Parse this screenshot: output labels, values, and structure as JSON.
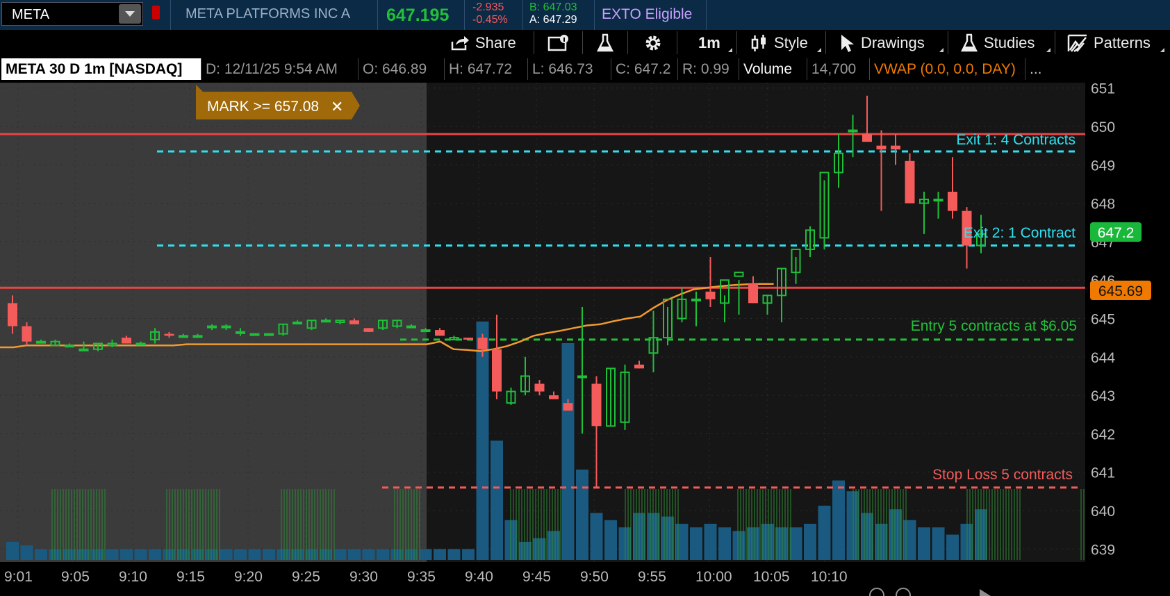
{
  "top_bar": {
    "symbol": "META",
    "company_name": "META PLATFORMS INC A",
    "last_price": "647.195",
    "net_change": "-2.935",
    "pct_change": "-0.45%",
    "bid": "B: 647.03",
    "ask": "A: 647.29",
    "exto": "EXTO Eligible"
  },
  "toolbar": {
    "share": "Share",
    "timeframe": "1m",
    "style": "Style",
    "drawings": "Drawings",
    "studies": "Studies",
    "patterns": "Patterns"
  },
  "info_bar": {
    "title": "META 30 D 1m [NASDAQ]",
    "date": "D: 12/11/25 9:54 AM",
    "open": "O: 646.89",
    "high": "H: 647.72",
    "low": "L: 646.73",
    "close": "C: 647.2",
    "range": "R: 0.99",
    "volume_label": "Volume",
    "volume_value": "14,700",
    "vwap": "VWAP (0.0, 0.0, DAY)",
    "more": "..."
  },
  "chart": {
    "alert_label": "MARK >= 657.08",
    "last_price_tag": "647.2",
    "vwap_tag": "645.69",
    "y_ticks": [
      "651",
      "650",
      "649",
      "648",
      "647",
      "646",
      "645",
      "644",
      "643",
      "642",
      "641",
      "640",
      "639"
    ],
    "x_ticks": [
      "9:01",
      "9:05",
      "9:10",
      "9:15",
      "9:20",
      "9:25",
      "9:30",
      "9:35",
      "9:40",
      "9:45",
      "9:50",
      "9:55",
      "10:00",
      "10:05",
      "10:10"
    ],
    "annotations": {
      "exit1": "Exit 1: 4 Contracts",
      "exit2": "Exit 2: 1 Contract",
      "entry": "Entry 5 contracts at $6.05",
      "stop": "Stop Loss 5 contracts"
    },
    "colors": {
      "up": "#1fbf3a",
      "down": "#f45b5b",
      "vwap": "#f29a2e",
      "volume": "#1a5a80",
      "cyan": "#2ee0f0",
      "green_dash": "#22c03a",
      "red_line": "#e84545"
    }
  },
  "chart_data": {
    "type": "candlestick",
    "title": "META 30 D 1m [NASDAQ]",
    "ylim": [
      638.7,
      651.3
    ],
    "horizontal_lines": [
      649.8,
      645.8
    ],
    "dashed_lines": [
      {
        "label": "Exit 1: 4 Contracts",
        "y": 649.35
      },
      {
        "label": "Exit 2: 1 Contract",
        "y": 646.9
      },
      {
        "label": "Entry 5 contracts at $6.05",
        "y": 644.45
      },
      {
        "label": "Stop Loss 5 contracts",
        "y": 640.6
      }
    ],
    "candles": [
      [
        645.4,
        645.6,
        644.6,
        644.8
      ],
      [
        644.8,
        644.9,
        644.3,
        644.4
      ],
      [
        644.4,
        644.45,
        644.35,
        644.4
      ],
      [
        644.3,
        644.45,
        644.3,
        644.4
      ],
      [
        644.3,
        644.35,
        644.25,
        644.3
      ],
      [
        644.2,
        644.4,
        644.15,
        644.2
      ],
      [
        644.2,
        644.35,
        644.15,
        644.35
      ],
      [
        644.3,
        644.45,
        644.25,
        644.35
      ],
      [
        644.5,
        644.55,
        644.35,
        644.35
      ],
      [
        644.35,
        644.4,
        644.3,
        644.35
      ],
      [
        644.45,
        644.75,
        644.35,
        644.65
      ],
      [
        644.6,
        644.65,
        644.5,
        644.55
      ],
      [
        644.55,
        644.6,
        644.5,
        644.55
      ],
      [
        644.55,
        644.6,
        644.5,
        644.55
      ],
      [
        644.8,
        644.85,
        644.7,
        644.8
      ],
      [
        644.8,
        644.85,
        644.7,
        644.8
      ],
      [
        644.65,
        644.75,
        644.55,
        644.65
      ],
      [
        644.6,
        644.6,
        644.6,
        644.6
      ],
      [
        644.6,
        644.6,
        644.6,
        644.6
      ],
      [
        644.6,
        644.85,
        644.55,
        644.85
      ],
      [
        644.9,
        644.95,
        644.85,
        644.9
      ],
      [
        644.75,
        644.95,
        644.7,
        644.95
      ],
      [
        644.95,
        645.0,
        644.9,
        644.95
      ],
      [
        644.9,
        644.95,
        644.85,
        644.95
      ],
      [
        644.95,
        645.0,
        644.85,
        644.85
      ],
      [
        644.75,
        644.75,
        644.65,
        644.65
      ],
      [
        644.75,
        644.95,
        644.7,
        644.95
      ],
      [
        644.8,
        644.95,
        644.75,
        644.95
      ],
      [
        644.8,
        644.85,
        644.75,
        644.8
      ],
      [
        644.7,
        644.75,
        644.65,
        644.7
      ],
      [
        644.7,
        644.75,
        644.55,
        644.55
      ],
      [
        644.45,
        644.55,
        644.45,
        644.5
      ],
      [
        644.5,
        644.5,
        644.45,
        644.45
      ],
      [
        644.5,
        644.6,
        644.0,
        644.2
      ],
      [
        644.2,
        645.1,
        642.9,
        643.1
      ],
      [
        642.8,
        643.2,
        642.75,
        643.1
      ],
      [
        643.1,
        644.0,
        643.0,
        643.5
      ],
      [
        643.3,
        643.4,
        643.0,
        643.1
      ],
      [
        643.0,
        643.1,
        642.9,
        642.9
      ],
      [
        642.8,
        642.9,
        642.6,
        642.6
      ],
      [
        643.5,
        645.3,
        642.0,
        643.5
      ],
      [
        643.3,
        643.5,
        640.6,
        642.2
      ],
      [
        642.2,
        643.7,
        642.2,
        643.7
      ],
      [
        642.3,
        643.8,
        642.1,
        643.6
      ],
      [
        643.8,
        643.9,
        643.7,
        643.7
      ],
      [
        644.1,
        645.2,
        643.6,
        644.5
      ],
      [
        644.5,
        645.3,
        644.3,
        645.5
      ],
      [
        645.0,
        645.8,
        644.9,
        645.5
      ],
      [
        645.5,
        645.7,
        644.8,
        645.5
      ],
      [
        645.7,
        646.6,
        645.3,
        645.5
      ],
      [
        645.4,
        645.6,
        644.9,
        646.0
      ],
      [
        646.1,
        646.0,
        645.1,
        646.2
      ],
      [
        645.9,
        646.1,
        645.4,
        645.4
      ],
      [
        645.4,
        645.6,
        645.1,
        645.6
      ],
      [
        645.6,
        646.3,
        644.9,
        646.3
      ],
      [
        646.2,
        646.6,
        645.9,
        646.8
      ],
      [
        646.8,
        647.4,
        646.6,
        647.3
      ],
      [
        647.1,
        648.6,
        646.8,
        648.8
      ],
      [
        648.8,
        649.8,
        648.4,
        649.3
      ],
      [
        649.9,
        650.3,
        649.2,
        649.9
      ],
      [
        649.8,
        650.8,
        649.6,
        649.6
      ],
      [
        649.5,
        649.9,
        647.8,
        649.4
      ],
      [
        649.5,
        649.8,
        649.0,
        649.4
      ],
      [
        649.1,
        649.3,
        648.0,
        648.0
      ],
      [
        648.0,
        648.3,
        647.2,
        648.1
      ],
      [
        648.1,
        648.3,
        647.6,
        648.1
      ],
      [
        648.3,
        649.2,
        647.6,
        647.8
      ],
      [
        647.8,
        647.9,
        646.3,
        646.9
      ],
      [
        646.9,
        647.7,
        646.7,
        647.2
      ]
    ]
  }
}
